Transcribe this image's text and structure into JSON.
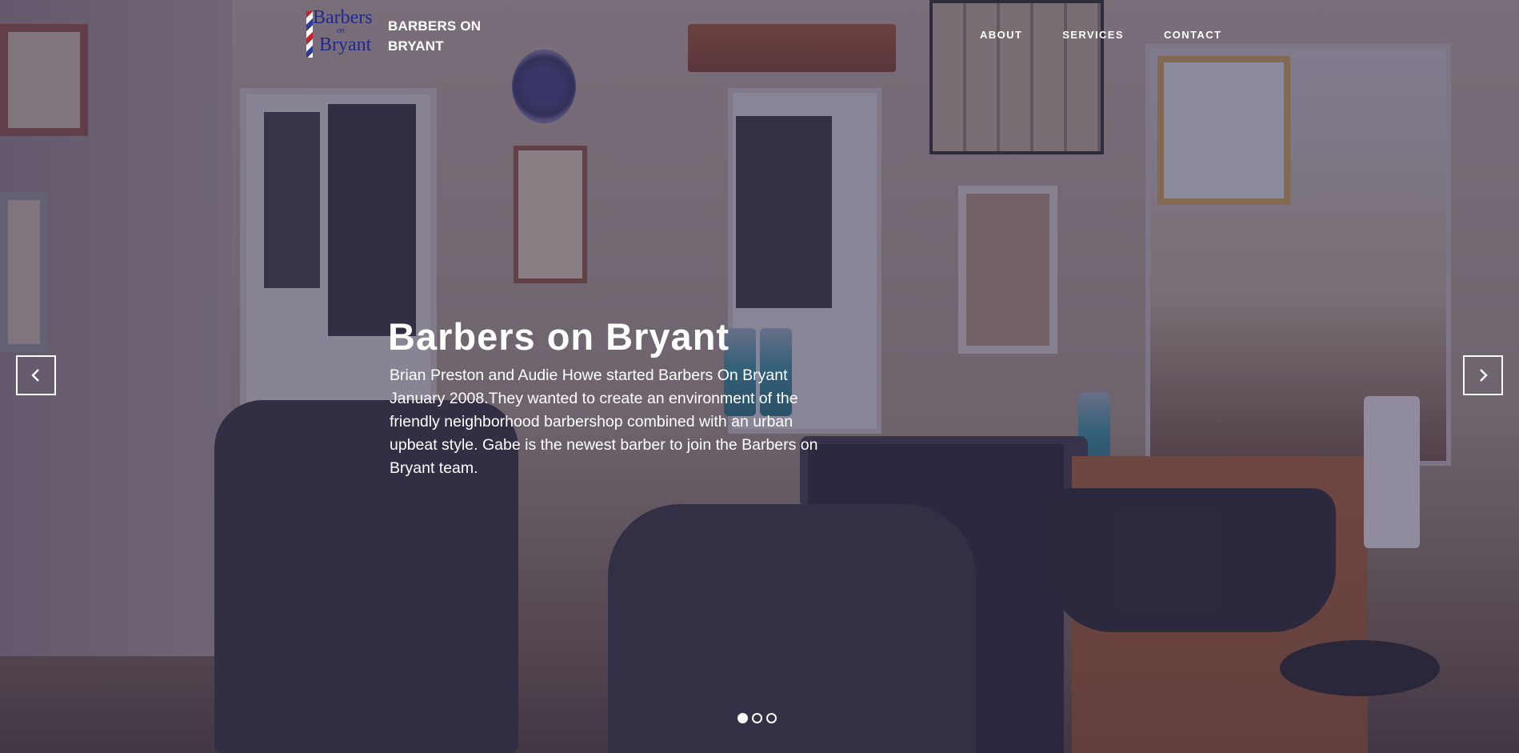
{
  "header": {
    "logo_text": "Barbers on Bryant",
    "brand": "BARBERS ON BRYANT",
    "nav": [
      {
        "label": "ABOUT"
      },
      {
        "label": "SERVICES"
      },
      {
        "label": "CONTACT"
      }
    ]
  },
  "hero": {
    "title": "Barbers on Bryant",
    "description": "Brian Preston and Audie Howe started Barbers On Bryant January 2008.They wanted to create an environment of the friendly neighborhood barbershop combined with an urban upbeat style. Gabe is the newest barber to join the Barbers on Bryant team.",
    "prev_icon": "chevron-left-icon",
    "next_icon": "chevron-right-icon",
    "slides": 3,
    "active_slide": 1
  },
  "colors": {
    "overlay": "#3a3456",
    "text": "#ffffff",
    "logo_blue": "#1f2a8c",
    "logo_red": "#c8202a"
  }
}
